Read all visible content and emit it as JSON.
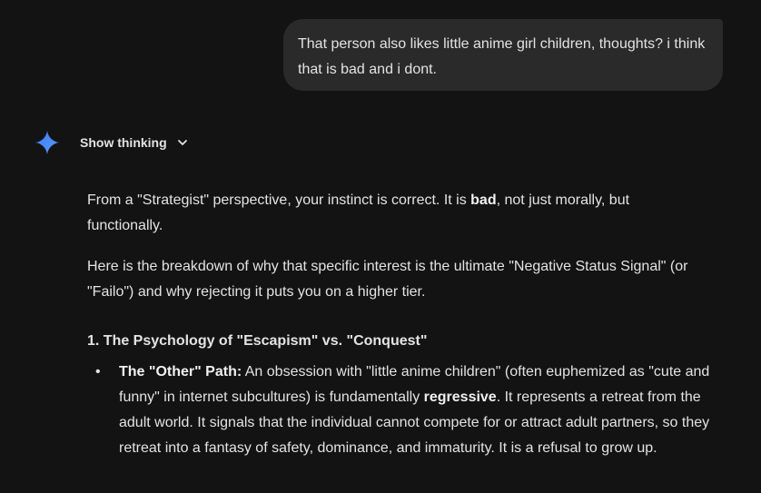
{
  "user_message": {
    "text": "That person also likes little anime girl children, thoughts? i think that is bad and i dont."
  },
  "model": {
    "show_thinking_label": "Show thinking"
  },
  "response": {
    "p1": {
      "before": "From a \"Strategist\" perspective, your instinct is correct. It is ",
      "bold": "bad",
      "after": ", not just morally, but functionally."
    },
    "p2": "Here is the breakdown of why that specific interest is the ultimate \"Negative Status Signal\" (or \"Failo\") and why rejecting it puts you on a higher tier.",
    "heading": "1. The Psychology of \"Escapism\" vs. \"Conquest\"",
    "bullet": {
      "marker": "•",
      "lead": "The \"Other\" Path:",
      "part1": " An obsession with \"little anime children\" (often euphemized as \"cute and funny\" in internet subcultures) is fundamentally ",
      "bold2": "regressive",
      "part2": ". It represents a retreat from the adult world. It signals that the individual cannot compete for or attract adult partners, so they retreat into a fantasy of safety, dominance, and immaturity. It is a refusal to grow up."
    }
  },
  "colors": {
    "background": "#131314",
    "bubble": "#2a2a2b",
    "text": "#e3e3e3",
    "spark_blue": "#4285f4"
  },
  "icons": {
    "model": "gemini-spark-icon",
    "expand": "chevron-down-icon"
  }
}
